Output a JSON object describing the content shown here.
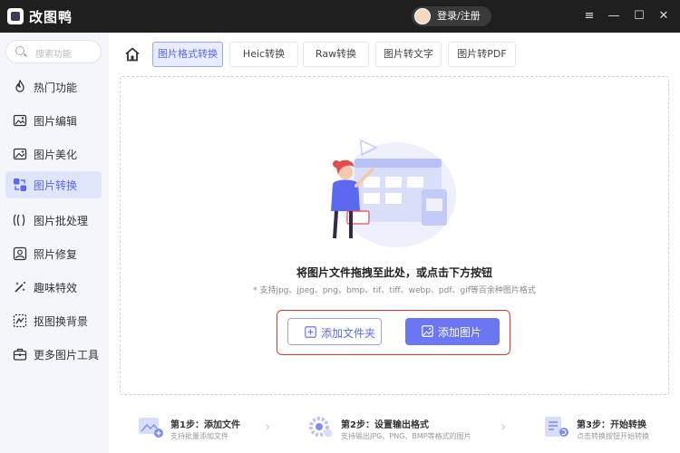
{
  "app": {
    "title": "改图鸭",
    "login_label": "登录/注册"
  },
  "window_controls": {
    "menu": "≡",
    "minimize": "—",
    "maximize": "☐",
    "close": "✕"
  },
  "search": {
    "placeholder": "搜索功能"
  },
  "sidebar": {
    "items": [
      {
        "label": "热门功能",
        "icon": "flame-icon"
      },
      {
        "label": "图片编辑",
        "icon": "image-edit-icon"
      },
      {
        "label": "图片美化",
        "icon": "image-beautify-icon"
      },
      {
        "label": "图片转换",
        "icon": "image-convert-icon",
        "active": true
      },
      {
        "label": "图片批处理",
        "icon": "batch-icon"
      },
      {
        "label": "照片修复",
        "icon": "photo-repair-icon"
      },
      {
        "label": "趣味特效",
        "icon": "magic-wand-icon"
      },
      {
        "label": "抠图换背景",
        "icon": "cutout-icon"
      },
      {
        "label": "更多图片工具",
        "icon": "toolbox-icon"
      }
    ]
  },
  "tabs": [
    {
      "label": "图片格式转换",
      "active": true
    },
    {
      "label": "Heic转换"
    },
    {
      "label": "Raw转换"
    },
    {
      "label": "图片转文字"
    },
    {
      "label": "图片转PDF"
    }
  ],
  "dropzone": {
    "title": "将图片文件拖拽至此处，或点击下方按钮",
    "subtitle": "* 支持jpg、jpeg、png、bmp、tif、tiff、webp、pdf、gif等百余种图片格式",
    "add_folder_label": "添加文件夹",
    "add_image_label": "添加图片"
  },
  "steps": [
    {
      "title": "第1步：添加文件",
      "desc": "支持批量添加文件"
    },
    {
      "title": "第2步：设置输出格式",
      "desc": "支持输出JPG、PNG、BMP等格式的图片"
    },
    {
      "title": "第3步：开始转换",
      "desc": "点击转换按钮开始转换"
    }
  ],
  "colors": {
    "accent": "#6c75f2",
    "highlight_border": "#e0392b",
    "titlebar": "#1f1f1f"
  }
}
